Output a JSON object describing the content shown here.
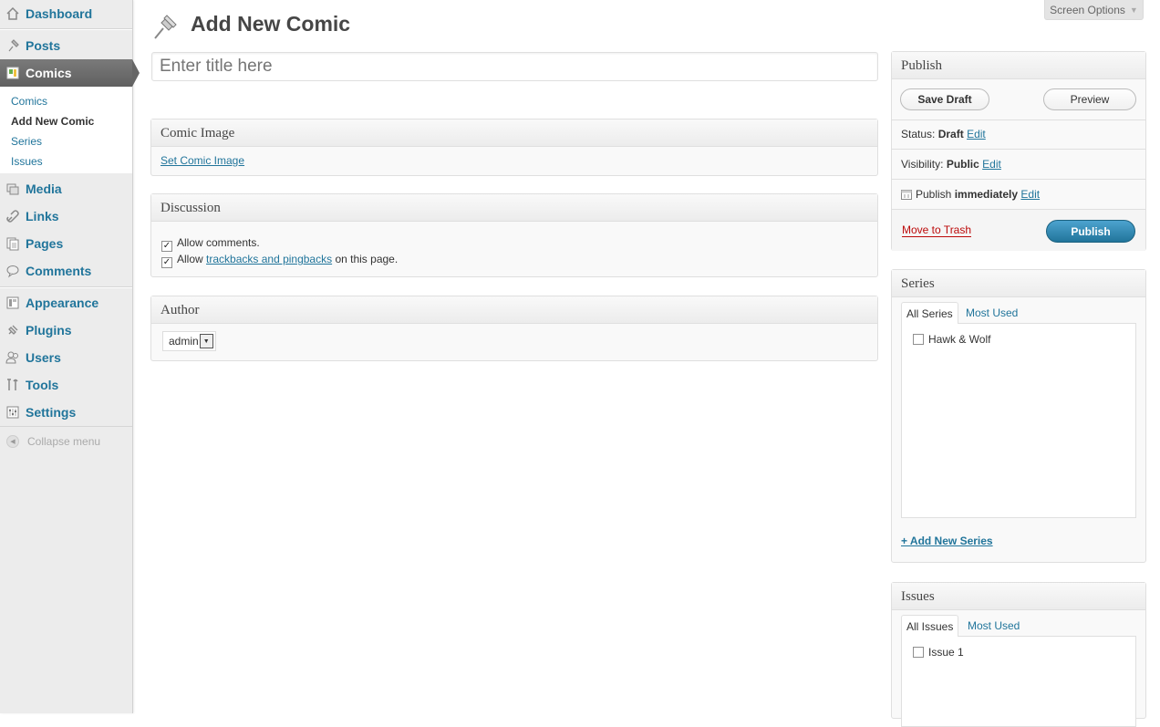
{
  "sidebar": {
    "items": [
      {
        "label": "Dashboard",
        "icon": "dashboard-icon"
      },
      {
        "label": "Posts",
        "icon": "pushpin-icon"
      },
      {
        "label": "Comics",
        "icon": "comics-icon"
      },
      {
        "label": "Media",
        "icon": "media-icon"
      },
      {
        "label": "Links",
        "icon": "link-icon"
      },
      {
        "label": "Pages",
        "icon": "pages-icon"
      },
      {
        "label": "Comments",
        "icon": "comment-icon"
      },
      {
        "label": "Appearance",
        "icon": "appearance-icon"
      },
      {
        "label": "Plugins",
        "icon": "plugin-icon"
      },
      {
        "label": "Users",
        "icon": "users-icon"
      },
      {
        "label": "Tools",
        "icon": "tools-icon"
      },
      {
        "label": "Settings",
        "icon": "settings-icon"
      }
    ],
    "submenu": [
      "Comics",
      "Add New Comic",
      "Series",
      "Issues"
    ],
    "collapse": "Collapse menu"
  },
  "header": {
    "screen_options": "Screen Options",
    "title": "Add New Comic"
  },
  "editor": {
    "title_placeholder": "Enter title here"
  },
  "comic_image": {
    "title": "Comic Image",
    "link": "Set Comic Image"
  },
  "discussion": {
    "title": "Discussion",
    "allow_comments": "Allow comments.",
    "allow_prefix": "Allow",
    "trackbacks_link": "trackbacks and pingbacks",
    "allow_suffix": "on this page."
  },
  "author": {
    "title": "Author",
    "selected": "admin"
  },
  "publish": {
    "title": "Publish",
    "save_draft": "Save Draft",
    "preview": "Preview",
    "status_label": "Status:",
    "status_value": "Draft",
    "visibility_label": "Visibility:",
    "visibility_value": "Public",
    "schedule_label": "Publish",
    "schedule_value": "immediately",
    "edit": "Edit",
    "move_to_trash": "Move to Trash",
    "publish_button": "Publish",
    "colors": {
      "publish": "#2a8bbd",
      "trash": "#bc0b0b"
    }
  },
  "series": {
    "title": "Series",
    "tabs": [
      "All Series",
      "Most Used"
    ],
    "items": [
      "Hawk & Wolf"
    ],
    "add_new": "+ Add New Series"
  },
  "issues": {
    "title": "Issues",
    "tabs": [
      "All Issues",
      "Most Used"
    ],
    "items": [
      "Issue 1"
    ]
  }
}
